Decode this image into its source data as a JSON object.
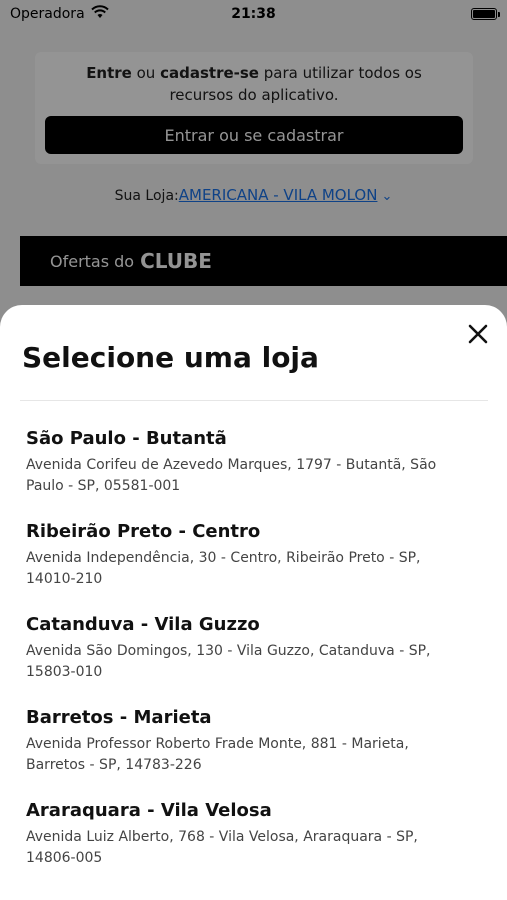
{
  "status_bar": {
    "carrier": "Operadora",
    "time": "21:38"
  },
  "login_card": {
    "text_bold1": "Entre",
    "text_mid1": " ou ",
    "text_bold2": "cadastre-se",
    "text_rest": " para utilizar todos os recursos do aplicativo.",
    "button_label": "Entrar ou se cadastrar"
  },
  "store_selector": {
    "label": "Sua Loja:",
    "store": "AMERICANA - VILA MOLON"
  },
  "club_banner": {
    "prefix": "Ofertas do",
    "strong": "CLUBE"
  },
  "sheet": {
    "title": "Selecione uma loja",
    "stores": [
      {
        "name": "São Paulo - Butantã",
        "address": "Avenida Corifeu de Azevedo Marques, 1797 - Butantã, São Paulo - SP, 05581-001"
      },
      {
        "name": "Ribeirão Preto - Centro",
        "address": "Avenida Independência, 30 - Centro, Ribeirão Preto - SP, 14010-210"
      },
      {
        "name": "Catanduva - Vila Guzzo",
        "address": "Avenida São Domingos, 130 - Vila Guzzo, Catanduva - SP, 15803-010"
      },
      {
        "name": "Barretos - Marieta",
        "address": "Avenida Professor Roberto Frade Monte, 881 - Marieta, Barretos - SP, 14783-226"
      },
      {
        "name": "Araraquara - Vila Velosa",
        "address": "Avenida Luiz Alberto, 768 - Vila Velosa, Araraquara - SP, 14806-005"
      }
    ]
  },
  "icons": {
    "wifi": "wifi-icon",
    "battery": "battery-icon",
    "chevron": "chevron-down-icon",
    "close": "close-icon"
  },
  "colors": {
    "accent_link": "#1a73e8",
    "primary_button": "#000000"
  }
}
